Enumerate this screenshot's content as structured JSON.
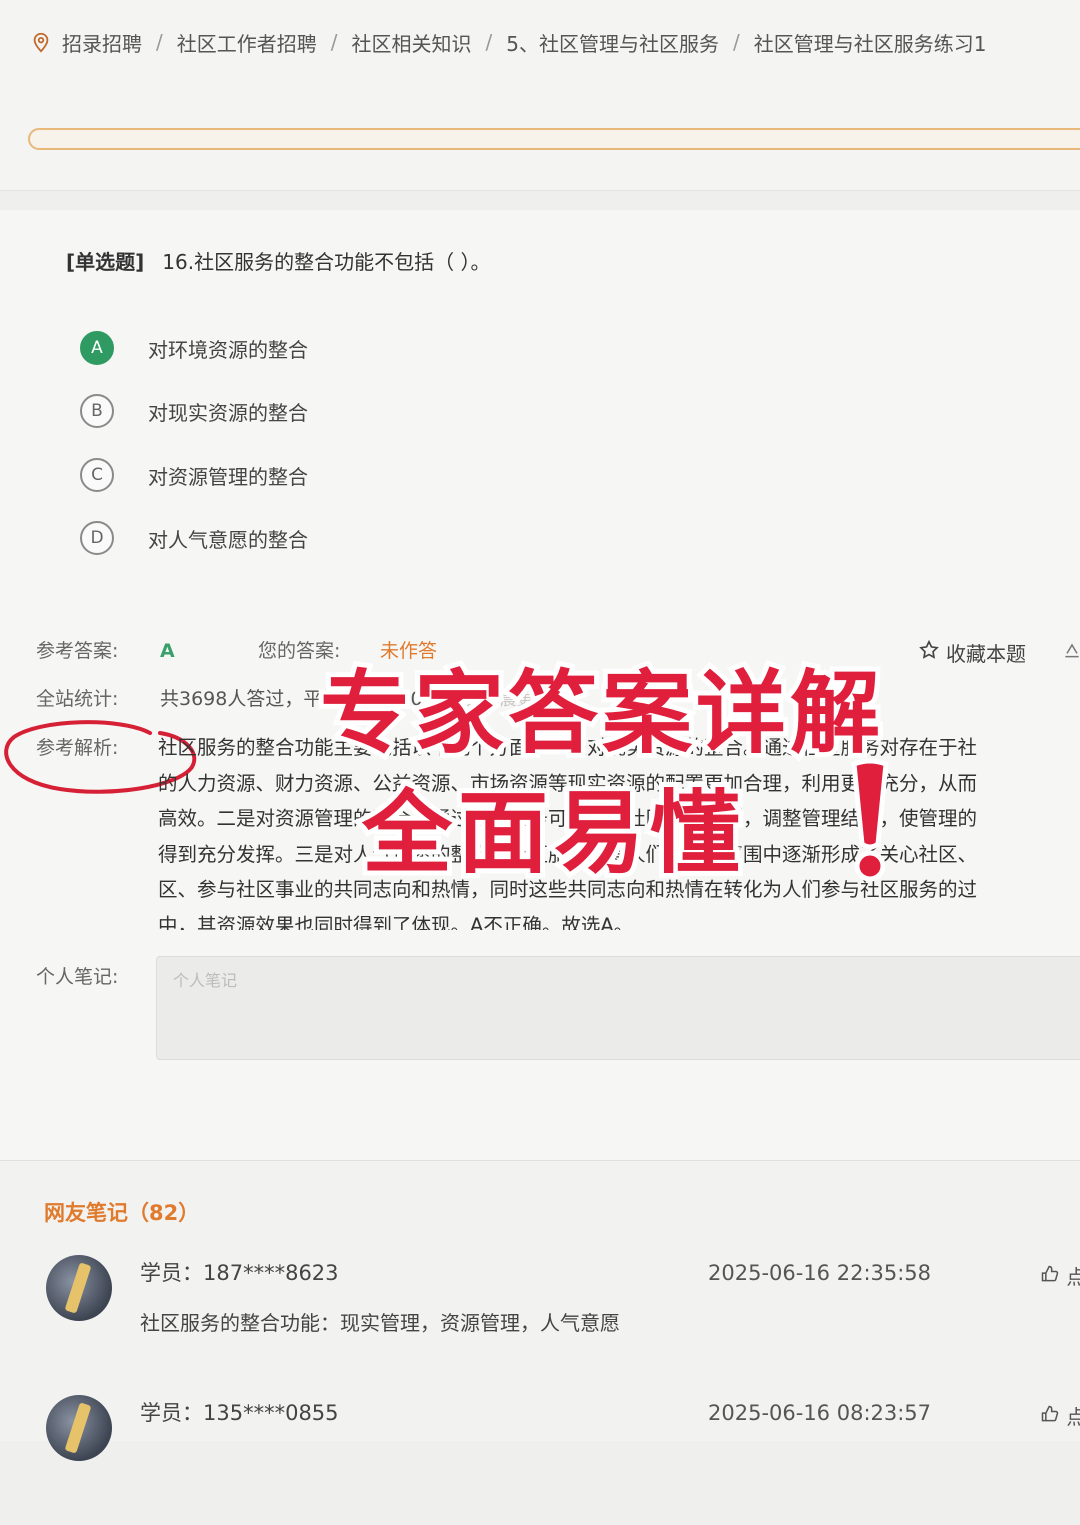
{
  "breadcrumb": {
    "icon": "location-pin-icon",
    "items": [
      "招录招聘",
      "社区工作者招聘",
      "社区相关知识",
      "5、社区管理与社区服务",
      "社区管理与社区服务练习1"
    ],
    "separator": "/"
  },
  "question": {
    "type_label": "[单选题]",
    "text": "16.社区服务的整合功能不包括（ ）。",
    "options": [
      {
        "letter": "A",
        "text": "对环境资源的整合",
        "selected": true
      },
      {
        "letter": "B",
        "text": "对现实资源的整合",
        "selected": false
      },
      {
        "letter": "C",
        "text": "对资源管理的整合",
        "selected": false
      },
      {
        "letter": "D",
        "text": "对人气意愿的整合",
        "selected": false
      }
    ]
  },
  "answer": {
    "ref_label": "参考答案:",
    "ref_value": "A",
    "yours_label": "您的答案:",
    "yours_value": "未作答",
    "favorite_label": "收藏本题"
  },
  "stats": {
    "label": "全站统计:",
    "text": "共3698人答过，平均正确率20%",
    "note": "每天凌晨更新"
  },
  "analysis": {
    "label": "参考解析:",
    "lines": [
      "社区服务的整合功能主要包括以下几个方面：一是对现实资源的整合。通过社区服务对存在于社",
      "的人力资源、财力资源、公益资源、市场资源等现实资源的配置更加合理，利用更加充分，从而",
      "高效。二是对资源管理的整合。通过社区服务可以理顺社区管理体制，调整管理结构，使管理的",
      "得到充分发挥。三是对人气意愿的整合。社区服务使得人们在社区氛围中逐渐形成了关心社区、",
      "区、参与社区事业的共同志向和热情，同时这些共同志向和热情在转化为人们参与社区服务的过",
      "中，其资源效果也同时得到了体现。A不正确。故选A。"
    ]
  },
  "note": {
    "label": "个人笔记:",
    "placeholder": "个人笔记"
  },
  "overlay": {
    "line1": "专家答案详解",
    "line2": "全面易懂"
  },
  "comments": {
    "title": "网友笔记（82）",
    "items": [
      {
        "user": "学员：187****8623",
        "time": "2025-06-16 22:35:58",
        "text": "社区服务的整合功能：现实管理，资源管理，人气意愿",
        "like": "点"
      },
      {
        "user": "学员：135****0855",
        "time": "2025-06-16 08:23:57",
        "text": "",
        "like": "点"
      }
    ]
  },
  "colors": {
    "accent_orange": "#e07b2e",
    "correct_green": "#2f9b62",
    "overlay_red": "#e01f3d"
  }
}
